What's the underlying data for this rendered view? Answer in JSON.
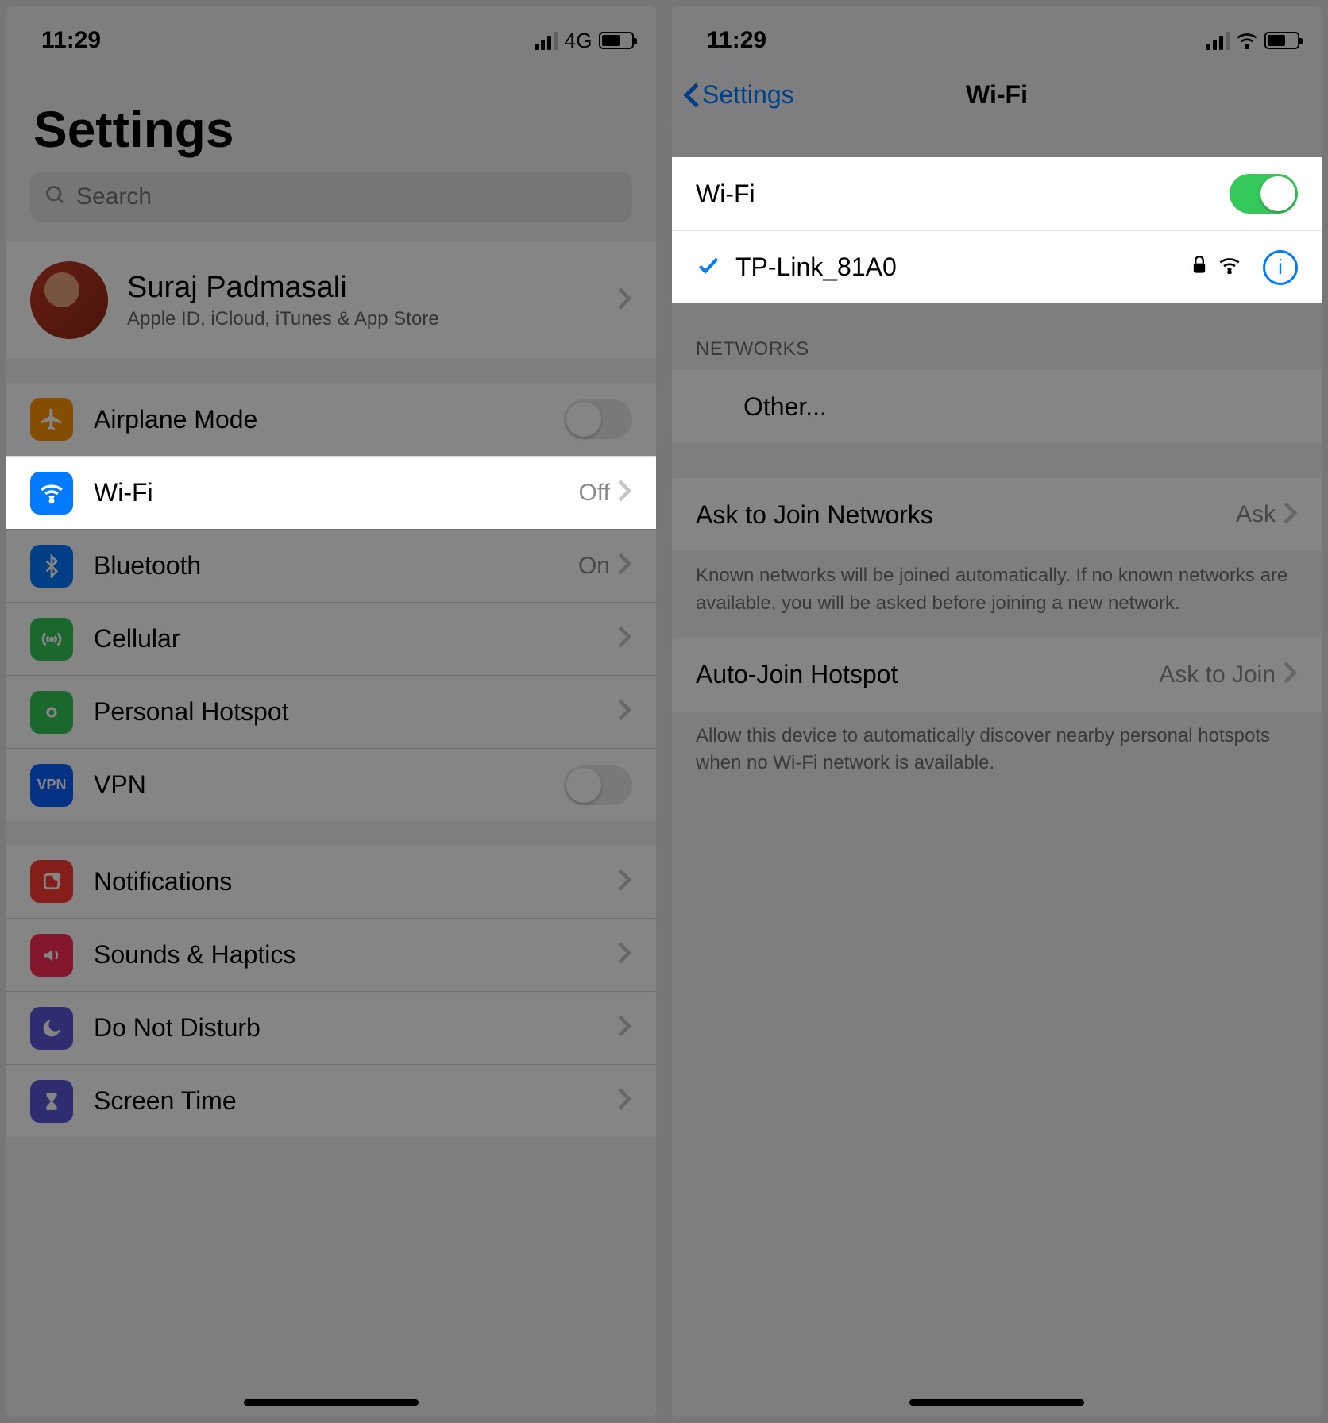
{
  "left": {
    "status": {
      "time": "11:29",
      "net": "4G"
    },
    "title": "Settings",
    "search_placeholder": "Search",
    "profile": {
      "name": "Suraj Padmasali",
      "sub": "Apple ID, iCloud, iTunes & App Store"
    },
    "rows": {
      "airplane": "Airplane Mode",
      "wifi": "Wi-Fi",
      "wifi_value": "Off",
      "bluetooth": "Bluetooth",
      "bluetooth_value": "On",
      "cellular": "Cellular",
      "hotspot": "Personal Hotspot",
      "vpn": "VPN",
      "notifications": "Notifications",
      "sounds": "Sounds & Haptics",
      "dnd": "Do Not Disturb",
      "screentime": "Screen Time"
    }
  },
  "right": {
    "status": {
      "time": "11:29"
    },
    "back_label": "Settings",
    "title": "Wi-Fi",
    "wifi_label": "Wi-Fi",
    "connected_network": "TP-Link_81A0",
    "networks_header": "NETWORKS",
    "other_label": "Other...",
    "join": {
      "label": "Ask to Join Networks",
      "value": "Ask"
    },
    "join_note": "Known networks will be joined automatically. If no known networks are available, you will be asked before joining a new network.",
    "hotspot": {
      "label": "Auto-Join Hotspot",
      "value": "Ask to Join"
    },
    "hotspot_note": "Allow this device to automatically discover nearby personal hotspots when no Wi-Fi network is available."
  }
}
